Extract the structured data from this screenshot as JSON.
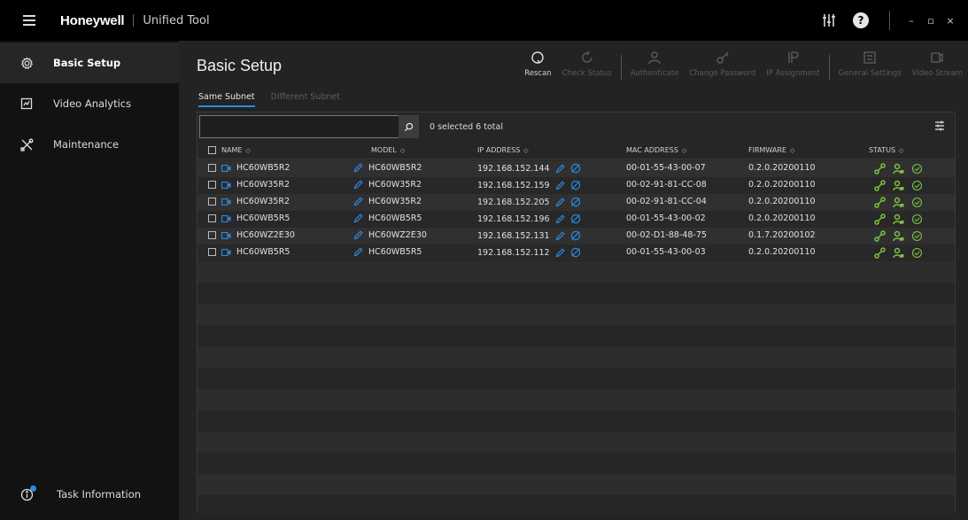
{
  "titlebar": {
    "brand": "Honeywell",
    "app_name": "Unified Tool",
    "window_controls": {
      "minimize": "–",
      "restore": "▫",
      "close": "×"
    }
  },
  "sidebar": {
    "items": [
      {
        "label": "Basic Setup",
        "icon": "gear-icon",
        "active": true
      },
      {
        "label": "Video Analytics",
        "icon": "analytics-icon",
        "active": false
      },
      {
        "label": "Maintenance",
        "icon": "tools-icon",
        "active": false
      }
    ],
    "task_info": "Task Information"
  },
  "main": {
    "title": "Basic Setup",
    "toolbar": [
      {
        "label": "Rescan",
        "enabled": true
      },
      {
        "label": "Check Status",
        "enabled": false
      },
      {
        "label": "Authenticate",
        "enabled": false
      },
      {
        "label": "Change Password",
        "enabled": false
      },
      {
        "label": "IP Assignment",
        "enabled": false
      },
      {
        "label": "General Settings",
        "enabled": false
      },
      {
        "label": "Video Stream",
        "enabled": false
      }
    ],
    "tabs": [
      {
        "label": "Same Subnet",
        "active": true
      },
      {
        "label": "Different Subnet",
        "active": false
      }
    ],
    "search": {
      "placeholder": "",
      "value": ""
    },
    "selected_count": "0 selected 6 total",
    "columns": [
      "NAME",
      "MODEL",
      "IP ADDRESS",
      "MAC ADDRESS",
      "FIRMWARE",
      "STATUS"
    ],
    "rows": [
      {
        "name": "HC60WB5R2",
        "model": "HC60WB5R2",
        "ip": "192.168.152.144",
        "mac": "00-01-55-43-00-07",
        "firmware": "0.2.0.20200110"
      },
      {
        "name": "HC60W35R2",
        "model": "HC60W35R2",
        "ip": "192.168.152.159",
        "mac": "00-02-91-81-CC-08",
        "firmware": "0.2.0.20200110"
      },
      {
        "name": "HC60W35R2",
        "model": "HC60W35R2",
        "ip": "192.168.152.205",
        "mac": "00-02-91-81-CC-04",
        "firmware": "0.2.0.20200110"
      },
      {
        "name": "HC60WB5R5",
        "model": "HC60WB5R5",
        "ip": "192.168.152.196",
        "mac": "00-01-55-43-00-02",
        "firmware": "0.2.0.20200110"
      },
      {
        "name": "HC60WZ2E30",
        "model": "HC60WZ2E30",
        "ip": "192.168.152.131",
        "mac": "00-02-D1-88-48-75",
        "firmware": "0.1.7.20200102"
      },
      {
        "name": "HC60WB5R5",
        "model": "HC60WB5R5",
        "ip": "192.168.152.112",
        "mac": "00-01-55-43-00-03",
        "firmware": "0.2.0.20200110"
      }
    ]
  },
  "colors": {
    "accent": "#2e8ae6",
    "status_green": "#7cc242",
    "camera_blue": "#2b8ae2"
  }
}
